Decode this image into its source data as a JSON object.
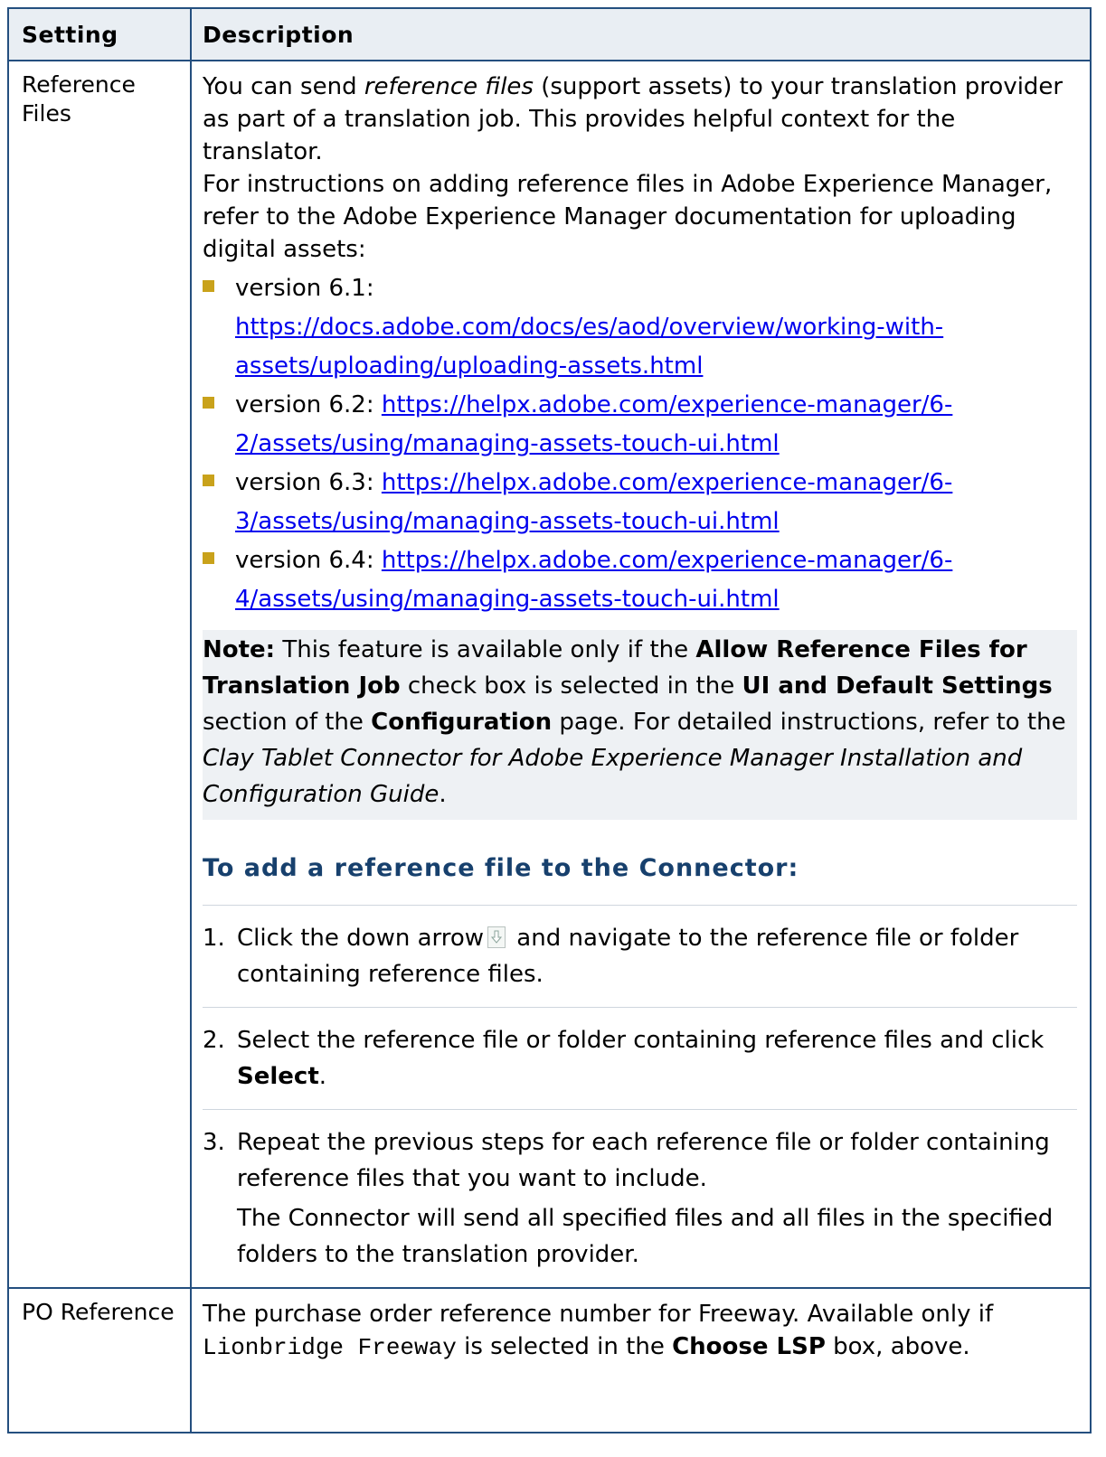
{
  "table": {
    "headers": [
      "Setting",
      "Description"
    ],
    "rows": [
      {
        "setting": "Reference Files",
        "intro_before": "You can send ",
        "intro_em": "reference files",
        "intro_after": " (support assets) to your translation provider as part of a translation job. This provides helpful context for the translator.",
        "instructions": "For instructions on adding reference files in Adobe Experience Manager, refer to the Adobe Experience Manager documentation for uploading digital assets:",
        "links": [
          {
            "label": "version 6.1:",
            "url": "https://docs.adobe.com/docs/es/aod/overview/working-with-assets/uploading/uploading-assets.html"
          },
          {
            "label": "version 6.2:",
            "url": "https://helpx.adobe.com/experience-manager/6-2/assets/using/managing-assets-touch-ui.html"
          },
          {
            "label": "version 6.3:",
            "url": "https://helpx.adobe.com/experience-manager/6-3/assets/using/managing-assets-touch-ui.html"
          },
          {
            "label": "version 6.4:",
            "url": "https://helpx.adobe.com/experience-manager/6-4/assets/using/managing-assets-touch-ui.html"
          }
        ],
        "note": {
          "label": "Note:",
          "t1": " This feature is available only if the ",
          "b1": "Allow Reference Files for Translation Job",
          "t2": " check box is selected in the ",
          "b2": "UI and Default Settings",
          "t3": " section of the ",
          "b3": "Configuration",
          "t4": " page. For detailed instructions, refer to the ",
          "em": "Clay Tablet Connector for Adobe Experience Manager Installation and Configuration Guide",
          "t5": "."
        },
        "procedure_title": "To add a reference file to the Connector:",
        "steps": {
          "s1_num": "1.",
          "s1_a": "Click the down arrow",
          "s1_b": " and navigate to the reference file or folder containing reference files.",
          "s2_num": "2.",
          "s2_a": "Select the reference file or folder containing reference files and click ",
          "s2_bold": "Select",
          "s2_b": ".",
          "s3_num": "3.",
          "s3_a": "Repeat the previous steps for each reference file or folder containing reference files that you want to include.",
          "s3_sub": "The Connector will send all specified files and all files in the specified folders to the translation provider."
        }
      },
      {
        "setting": "PO Reference",
        "t1": "The purchase order reference number for Freeway. Available only if ",
        "code": "Lionbridge Freeway",
        "t2": " is selected in the ",
        "bold": "Choose LSP",
        "t3": " box, above."
      }
    ]
  },
  "icons": {
    "down_arrow": "down-arrow-icon"
  },
  "colors": {
    "border": "#244f7f",
    "header_bg": "#e9eef3",
    "bullet": "#c9a21b",
    "link": "#0000ee",
    "procedure_title": "#17406d",
    "note_bg": "#eef1f4"
  }
}
